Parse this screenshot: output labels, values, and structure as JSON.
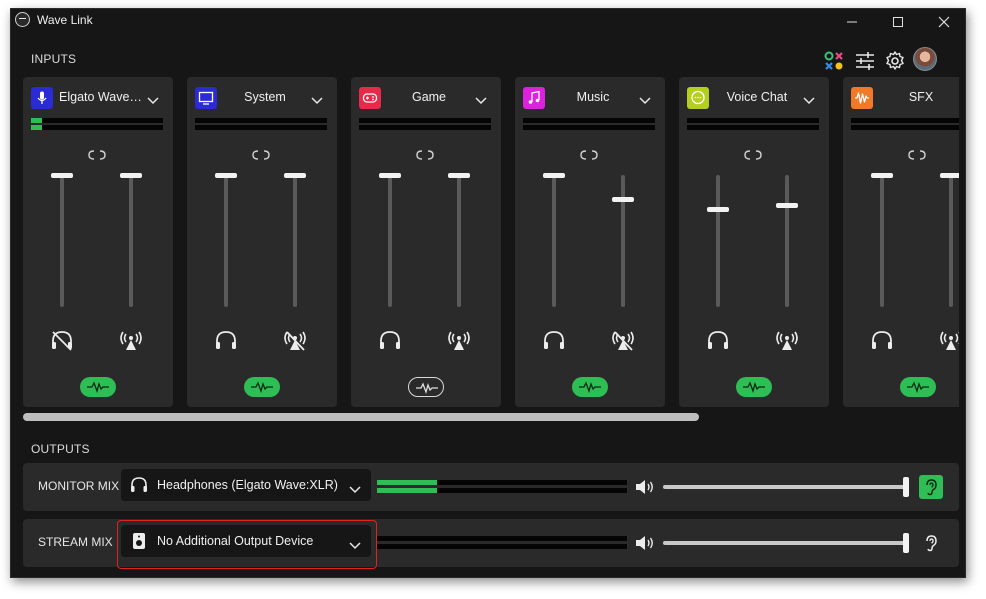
{
  "window": {
    "title": "Wave Link"
  },
  "inputs_label": "INPUTS",
  "outputs_label": "OUTPUTS",
  "colors": {
    "accent_green": "#2fbe55",
    "highlight_red": "#e0231b"
  },
  "channels": [
    {
      "name": "Elgato Wave ...",
      "icon": "microphone-icon",
      "color": "#2b2bd6",
      "meter_level": 0.08,
      "monitor_level": 1.0,
      "stream_level": 1.0,
      "monitor_muted": true,
      "stream_muted": false,
      "effects_on": true
    },
    {
      "name": "System",
      "icon": "monitor-icon",
      "color": "#2b2bd6",
      "meter_level": 0,
      "monitor_level": 1.0,
      "stream_level": 1.0,
      "monitor_muted": false,
      "stream_muted": true,
      "effects_on": true
    },
    {
      "name": "Game",
      "icon": "gamepad-icon",
      "color": "#e8294a",
      "meter_level": 0,
      "monitor_level": 1.0,
      "stream_level": 1.0,
      "monitor_muted": false,
      "stream_muted": false,
      "effects_on": false
    },
    {
      "name": "Music",
      "icon": "music-note-icon",
      "color": "#dd22dd",
      "meter_level": 0,
      "monitor_level": 1.0,
      "stream_level": 0.82,
      "monitor_muted": false,
      "stream_muted": true,
      "effects_on": true
    },
    {
      "name": "Voice Chat",
      "icon": "chat-bubble-icon",
      "color": "#b5cf1e",
      "meter_level": 0,
      "monitor_level": 0.74,
      "stream_level": 0.77,
      "monitor_muted": false,
      "stream_muted": false,
      "effects_on": true
    },
    {
      "name": "SFX",
      "icon": "sound-wave-icon",
      "color": "#f07a28",
      "meter_level": 0,
      "monitor_level": 1.0,
      "stream_level": 1.0,
      "monitor_muted": false,
      "stream_muted": false,
      "effects_on": true
    }
  ],
  "outputs": [
    {
      "label": "MONITOR MIX",
      "device": "Headphones (Elgato Wave:XLR)",
      "device_icon": "headphones-icon",
      "meter_level": 0.24,
      "volume": 1.0,
      "listen_on": true
    },
    {
      "label": "STREAM MIX",
      "device": "No Additional Output Device",
      "device_icon": "speaker-icon",
      "meter_level": 0,
      "volume": 1.0,
      "listen_on": false
    }
  ]
}
